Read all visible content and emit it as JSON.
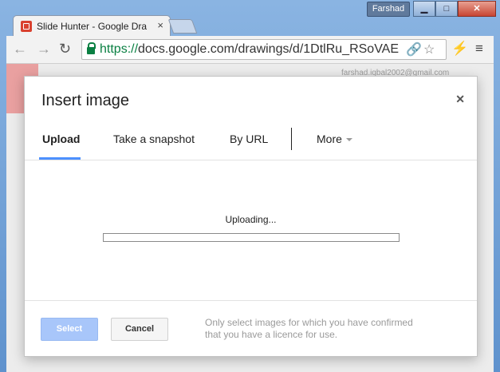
{
  "browser": {
    "tab_title": "Slide Hunter - Google Dra",
    "user_name": "Farshad",
    "url_scheme": "https://",
    "url_rest": "docs.google.com/drawings/d/1DtlRu_RSoVAE"
  },
  "page": {
    "email_partial": "farshad.iqbal2002@gmail.com"
  },
  "dialog": {
    "title": "Insert image",
    "tabs": [
      {
        "label": "Upload",
        "active": true
      },
      {
        "label": "Take a snapshot"
      },
      {
        "label": "By URL"
      },
      {
        "label": "More"
      }
    ],
    "status_text": "Uploading...",
    "progress": 0,
    "select_label": "Select",
    "cancel_label": "Cancel",
    "note_line1": "Only select images for which you have confirmed",
    "note_line2": "that you have a licence for use."
  },
  "colors": {
    "accent": "#4d90fe",
    "select_disabled": "#a8c6fa",
    "secure_green": "#0b8043"
  }
}
